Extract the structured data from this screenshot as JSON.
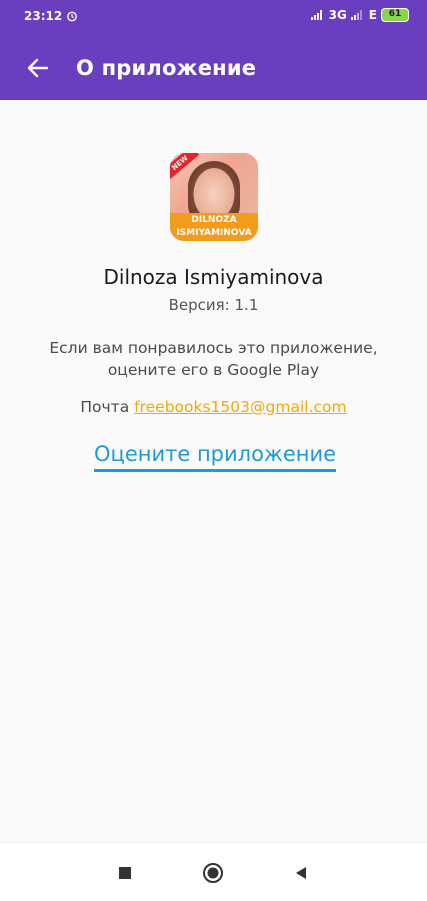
{
  "status_bar": {
    "time": "23:12",
    "network_label": "3G",
    "secondary_network_label": "E",
    "battery_level": "61",
    "icons": [
      "alarm-icon",
      "signal-icon",
      "signal-icon",
      "battery-icon"
    ]
  },
  "toolbar": {
    "title": "О приложение",
    "back_icon": "arrow-left-icon",
    "background_color": "#6a3fbf"
  },
  "app_info": {
    "icon_badge": "NEW",
    "icon_caption_line1": "DILNOZA",
    "icon_caption_line2": "ISMIYAMINOVA",
    "name": "Dilnoza Ismiyaminova",
    "version": "Версия: 1.1",
    "description": "Если вам понравилось это приложение, оцените его в Google Play",
    "mail_label": "Почта",
    "mail_address": "freebooks1503@gmail.com",
    "rate_label": "Оцените приложение"
  },
  "colors": {
    "accent": "#1f9ad6",
    "link": "#f3a70d",
    "battery": "#8bd34b"
  },
  "nav_bar": {
    "icons": [
      "square-icon",
      "circle-icon",
      "triangle-back-icon"
    ]
  }
}
